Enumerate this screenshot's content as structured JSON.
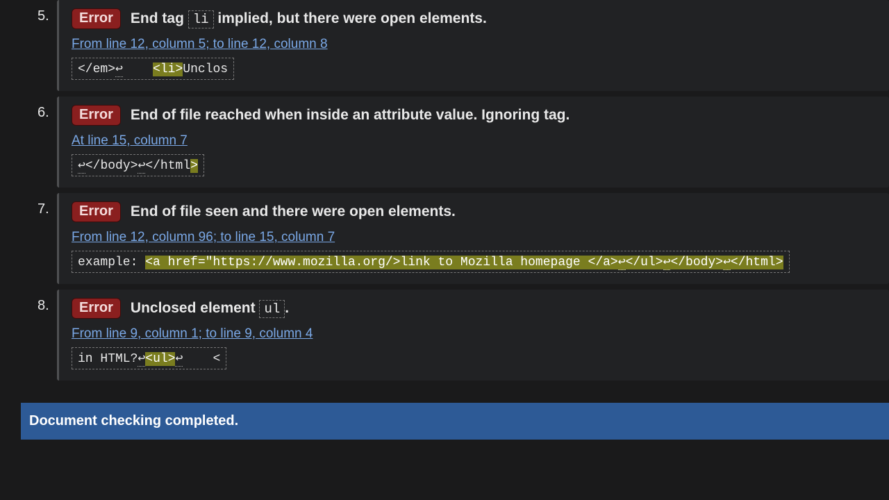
{
  "messages": [
    {
      "num": "5.",
      "badge": "Error",
      "text_pre": "End tag ",
      "code": "li",
      "text_post": " implied, but there were open elements.",
      "location": "From line 12, column 5; to line 12, column 8",
      "extract_pre": "</em>",
      "extract_nl1": "↩",
      "extract_mid": "    ",
      "extract_hilite": "<li>",
      "extract_post": "Unclos"
    },
    {
      "num": "6.",
      "badge": "Error",
      "text_full": "End of file reached when inside an attribute value. Ignoring tag.",
      "location": "At line 15, column 7",
      "extract_nl1": "↩",
      "extract_pre2": "</body>",
      "extract_nl2": "↩",
      "extract_mid": "</html",
      "extract_hilite": ">"
    },
    {
      "num": "7.",
      "badge": "Error",
      "text_full": "End of file seen and there were open elements.",
      "location": "From line 12, column 96; to line 15, column 7",
      "extract_pre": "example: ",
      "extract_hilite_a": "<a href=\"https://www.mozilla.org/>link to Mozilla homepage </a>",
      "extract_nl1": "↩",
      "extract_hilite_b": "</ul>",
      "extract_nl2": "↩",
      "extract_hilite_c": "</body>",
      "extract_nl3": "↩",
      "extract_hilite_d": "</html>"
    },
    {
      "num": "8.",
      "badge": "Error",
      "text_pre": "Unclosed element ",
      "code": "ul",
      "text_post": ".",
      "location": "From line 9, column 1; to line 9, column 4",
      "extract_pre": "in HTML?",
      "extract_nl1": "↩",
      "extract_hilite": "<ul>",
      "extract_nl2": "↩",
      "extract_post": "    <"
    }
  ],
  "footer": "Document checking completed."
}
